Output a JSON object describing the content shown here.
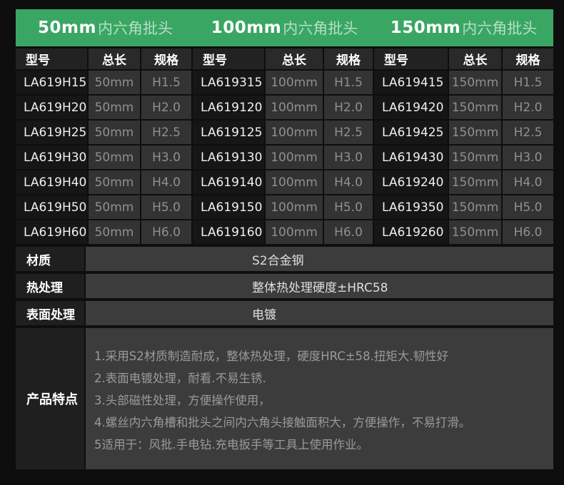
{
  "colors": {
    "accent_green": "#3aa663",
    "pale_green": "#b4dfc6",
    "page_bg": "#0e0e0e"
  },
  "header_bar": {
    "titles": [
      {
        "size": "50mm",
        "name": "内六角批头"
      },
      {
        "size": "100mm",
        "name": "内六角批头"
      },
      {
        "size": "150mm",
        "name": "内六角批头"
      }
    ]
  },
  "tables": [
    {
      "columns": [
        "型号",
        "总长",
        "规格"
      ],
      "rows": [
        [
          "LA619H15",
          "50mm",
          "H1.5"
        ],
        [
          "LA619H20",
          "50mm",
          "H2.0"
        ],
        [
          "LA619H25",
          "50mm",
          "H2.5"
        ],
        [
          "LA619H30",
          "50mm",
          "H3.0"
        ],
        [
          "LA619H40",
          "50mm",
          "H4.0"
        ],
        [
          "LA619H50",
          "50mm",
          "H5.0"
        ],
        [
          "LA619H60",
          "50mm",
          "H6.0"
        ]
      ]
    },
    {
      "columns": [
        "型号",
        "总长",
        "规格"
      ],
      "rows": [
        [
          "LA619315",
          "100mm",
          "H1.5"
        ],
        [
          "LA619120",
          "100mm",
          "H2.0"
        ],
        [
          "LA619125",
          "100mm",
          "H2.5"
        ],
        [
          "LA619130",
          "100mm",
          "H3.0"
        ],
        [
          "LA619140",
          "100mm",
          "H4.0"
        ],
        [
          "LA619150",
          "100mm",
          "H5.0"
        ],
        [
          "LA619160",
          "100mm",
          "H6.0"
        ]
      ]
    },
    {
      "columns": [
        "型号",
        "总长",
        "规格"
      ],
      "rows": [
        [
          "LA619415",
          "150mm",
          "H1.5"
        ],
        [
          "LA619420",
          "150mm",
          "H2.0"
        ],
        [
          "LA619425",
          "150mm",
          "H2.5"
        ],
        [
          "LA619430",
          "150mm",
          "H3.0"
        ],
        [
          "LA619240",
          "150mm",
          "H4.0"
        ],
        [
          "LA619350",
          "150mm",
          "H5.0"
        ],
        [
          "LA619260",
          "150mm",
          "H6.0"
        ]
      ]
    }
  ],
  "specs": [
    {
      "label": "材质",
      "value": "S2合金钢"
    },
    {
      "label": "热处理",
      "value": "整体热处理硬度±HRC58"
    },
    {
      "label": "表面处理",
      "value": "电镀"
    }
  ],
  "features": {
    "label": "产品特点",
    "lines": [
      "1.采用S2材质制造耐成，整体热处理，硬度HRC±58.扭矩大.韧性好",
      "2.表面电镀处理，耐看.不易生锈.",
      "3.头部磁性处理，方便操作使用，",
      "4.螺丝内六角槽和批头之间内六角头接触面积大，方便操作，不易打滑。",
      "5适用于：风批.手电钻.充电扳手等工具上使用作业。"
    ]
  }
}
